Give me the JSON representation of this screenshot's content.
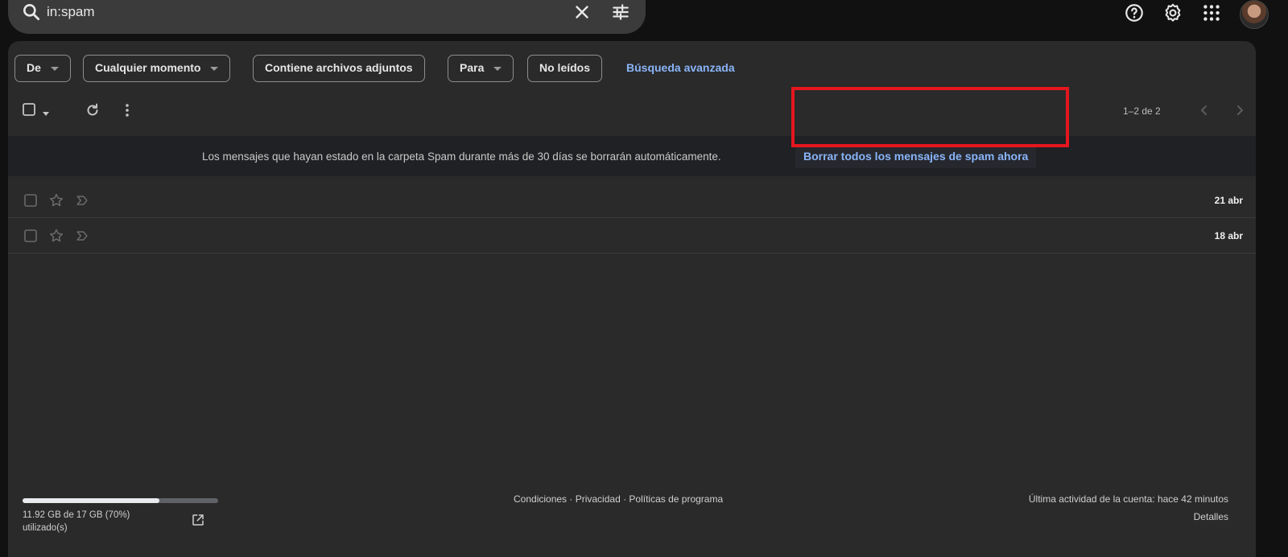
{
  "search": {
    "query": "in:spam"
  },
  "filters": {
    "chips": [
      {
        "label": "De",
        "dropdown": true
      },
      {
        "label": "Cualquier momento",
        "dropdown": true
      },
      {
        "label": "Contiene archivos adjuntos",
        "dropdown": false
      },
      {
        "label": "Para",
        "dropdown": true
      },
      {
        "label": "No leídos",
        "dropdown": false
      }
    ],
    "advanced_search": "Búsqueda avanzada"
  },
  "pagination": {
    "range": "1–2 de 2"
  },
  "banner": {
    "message": "Los mensajes que hayan estado en la carpeta Spam durante más de 30 días se borrarán automáticamente.",
    "action": "Borrar todos los mensajes de spam ahora"
  },
  "messages": [
    {
      "date": "21 abr"
    },
    {
      "date": "18 abr"
    }
  ],
  "storage": {
    "text": "11.92 GB de 17 GB (70%) utilizado(s)",
    "fraction": 0.7
  },
  "footer": {
    "terms": "Condiciones",
    "privacy": "Privacidad",
    "policies": "Políticas de programa",
    "separator": " · ",
    "activity": "Última actividad de la cuenta: hace 42 minutos",
    "details": "Detalles"
  },
  "colors": {
    "accent": "#8ab4f8",
    "highlight": "#e5161e",
    "panel": "#2a2a2a"
  }
}
